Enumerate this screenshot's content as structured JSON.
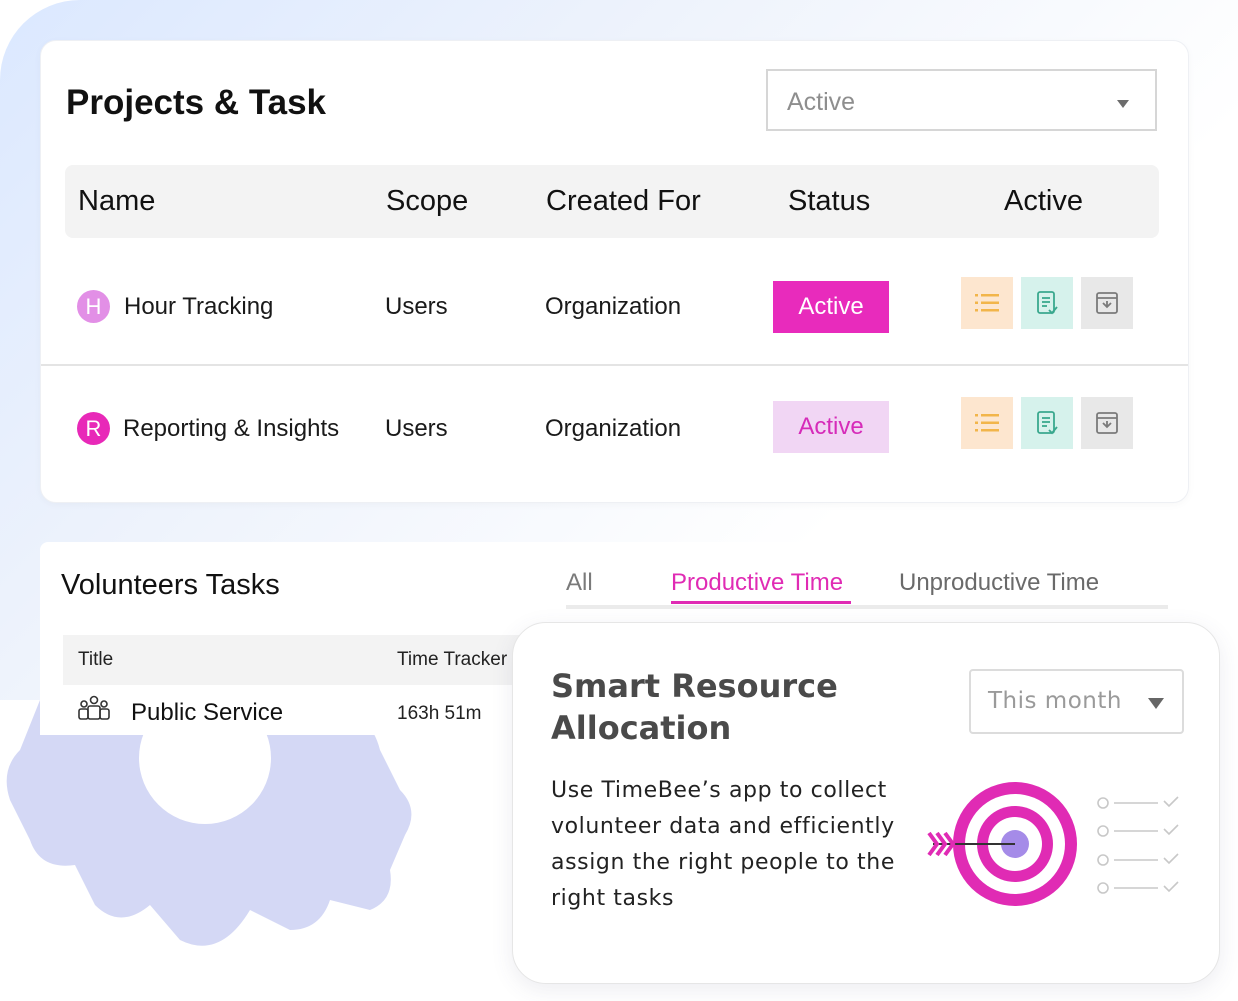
{
  "projects": {
    "title": "Projects & Task",
    "filter_value": "Active",
    "columns": [
      "Name",
      "Scope",
      "Created For",
      "Status",
      "Active"
    ],
    "rows": [
      {
        "initial": "H",
        "name": "Hour Tracking",
        "scope": "Users",
        "created_for": "Organization",
        "status": "Active",
        "avatar_color": "#e28fe6"
      },
      {
        "initial": "R",
        "name": "Reporting & Insights",
        "scope": "Users",
        "created_for": "Organization",
        "status": "Active",
        "avatar_color": "#e829b8"
      }
    ],
    "action_icons": [
      "list-icon",
      "document-icon",
      "archive-icon"
    ]
  },
  "volunteers": {
    "title": "Volunteers Tasks",
    "tabs": [
      "All",
      "Productive Time",
      "Unproductive Time"
    ],
    "active_tab": "Productive Time",
    "columns": [
      "Title",
      "Time Tracker"
    ],
    "rows": [
      {
        "icon": "people-icon",
        "title": "Public Service",
        "time": "163h 51m"
      }
    ]
  },
  "smart": {
    "title": "Smart Resource Allocation",
    "period": "This month",
    "description": "Use TimeBee’s app to collect volunteer data and efficiently assign the right people to the right tasks"
  },
  "colors": {
    "accent": "#e02bb4",
    "brand_light": "#f1d6f4",
    "gear": "#d4d8f5"
  }
}
